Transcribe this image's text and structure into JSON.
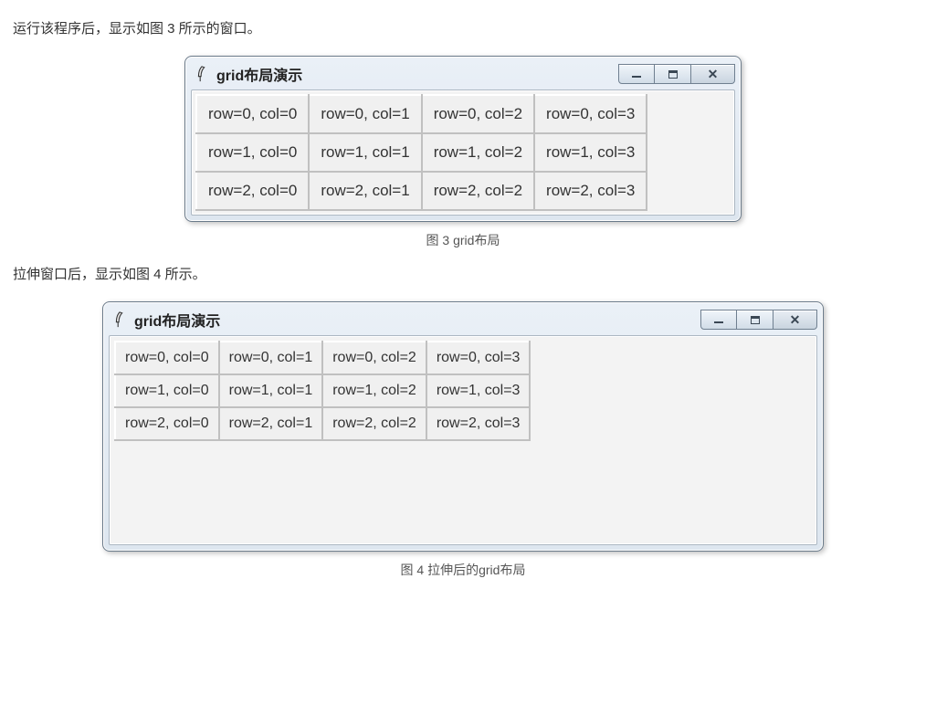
{
  "text_intro3": "运行该程序后，显示如图 3 所示的窗口。",
  "text_intro4": "拉伸窗口后，显示如图 4 所示。",
  "caption3": "图 3 grid布局",
  "caption4": "图 4 拉伸后的grid布局",
  "window_title": "grid布局演示",
  "icons": {
    "app": "feather-icon",
    "min": "minimize-icon",
    "max": "maximize-icon",
    "close": "close-icon"
  },
  "grid_cells": {
    "r0c0": "row=0, col=0",
    "r0c1": "row=0, col=1",
    "r0c2": "row=0, col=2",
    "r0c3": "row=0, col=3",
    "r1c0": "row=1, col=0",
    "r1c1": "row=1, col=1",
    "r1c2": "row=1, col=2",
    "r1c3": "row=1, col=3",
    "r2c0": "row=2, col=0",
    "r2c1": "row=2, col=1",
    "r2c2": "row=2, col=2",
    "r2c3": "row=2, col=3"
  }
}
